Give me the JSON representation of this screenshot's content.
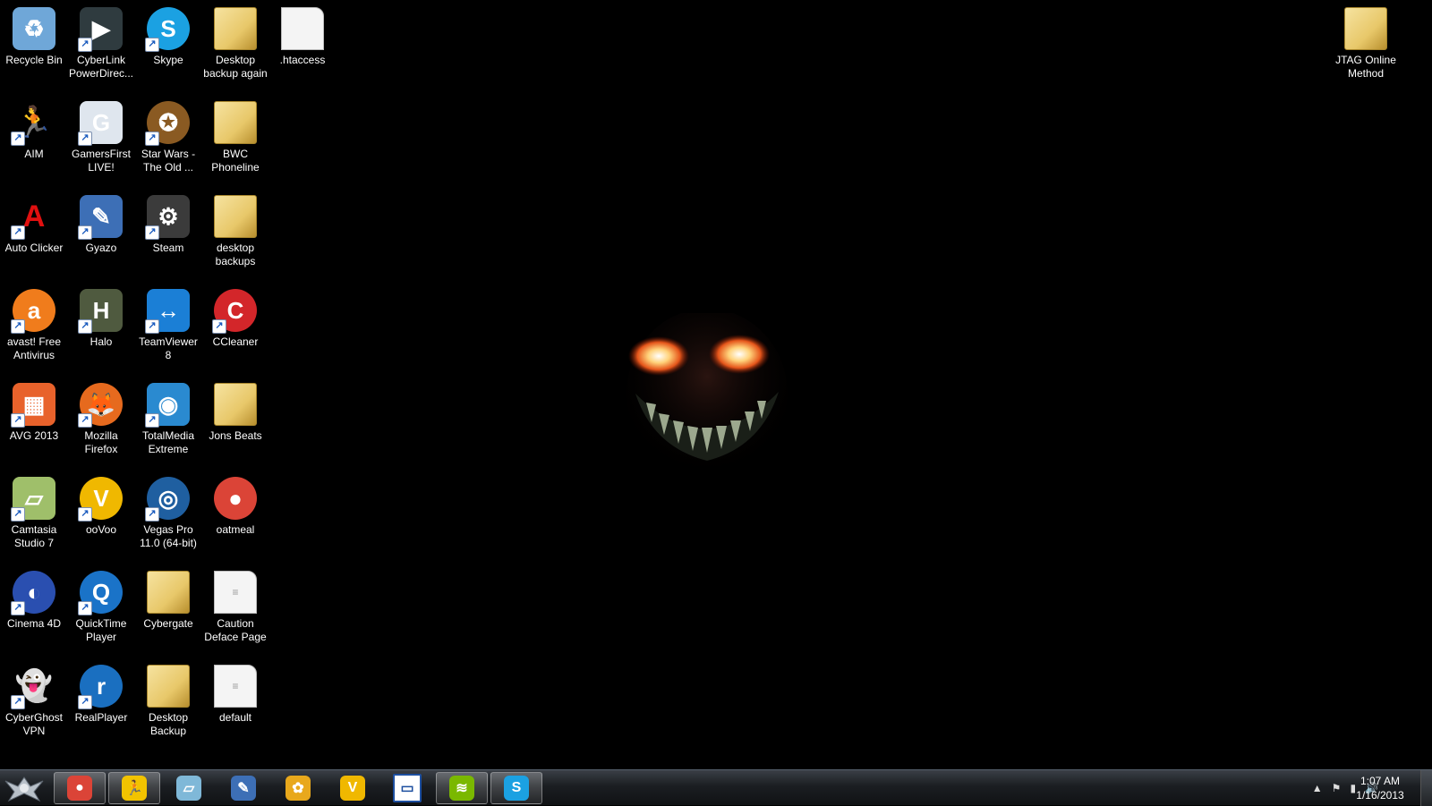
{
  "desktop": {
    "icons": [
      {
        "label": "Recycle Bin",
        "icon": "recycle-bin-icon",
        "color": "#6fa7d8",
        "glyph": "♻",
        "shortcut": false,
        "kind": "app",
        "name": "desktop-icon-recycle-bin"
      },
      {
        "label": "CyberLink PowerDirec...",
        "icon": "cyberlink-powerdirector-icon",
        "color": "#2f3b3f",
        "glyph": "▶",
        "shortcut": true,
        "kind": "app",
        "name": "desktop-icon-cyberlink-powerdirector"
      },
      {
        "label": "Skype",
        "icon": "skype-icon",
        "color": "#1ba1e2",
        "glyph": "S",
        "shortcut": true,
        "kind": "round",
        "name": "desktop-icon-skype"
      },
      {
        "label": "Desktop backup again",
        "icon": "folder-icon",
        "color": "#e8c86a",
        "glyph": "",
        "shortcut": false,
        "kind": "folder",
        "name": "desktop-icon-desktop-backup-again"
      },
      {
        "label": ".htaccess",
        "icon": "file-icon",
        "color": "#f4f4f4",
        "glyph": "",
        "shortcut": false,
        "kind": "file",
        "name": "desktop-icon-htaccess"
      },
      {
        "label": "AIM",
        "icon": "aim-running-man-icon",
        "color": "#000000",
        "glyph": "🏃",
        "shortcut": true,
        "kind": "app",
        "name": "desktop-icon-aim"
      },
      {
        "label": "GamersFirst LIVE!",
        "icon": "gamersfirst-icon",
        "color": "#dfe6ee",
        "glyph": "G",
        "shortcut": true,
        "kind": "app",
        "name": "desktop-icon-gamersfirst"
      },
      {
        "label": "Star Wars - The Old ...",
        "icon": "star-wars-old-republic-icon",
        "color": "#8a5a22",
        "glyph": "✪",
        "shortcut": true,
        "kind": "round",
        "name": "desktop-icon-star-wars"
      },
      {
        "label": "BWC Phoneline",
        "icon": "folder-icon",
        "color": "#e8c86a",
        "glyph": "",
        "shortcut": false,
        "kind": "folder",
        "name": "desktop-icon-bwc-phoneline"
      },
      {
        "label": "Auto Clicker",
        "icon": "auto-clicker-icon",
        "color": "#000000",
        "glyph": "A",
        "shortcut": true,
        "kind": "app",
        "name": "desktop-icon-auto-clicker"
      },
      {
        "label": "Gyazo",
        "icon": "gyazo-icon",
        "color": "#3d6fb6",
        "glyph": "✎",
        "shortcut": true,
        "kind": "app",
        "name": "desktop-icon-gyazo"
      },
      {
        "label": "Steam",
        "icon": "steam-icon",
        "color": "#3b3b3b",
        "glyph": "⚙",
        "shortcut": true,
        "kind": "app",
        "name": "desktop-icon-steam"
      },
      {
        "label": "desktop backups",
        "icon": "folder-icon",
        "color": "#e8c86a",
        "glyph": "",
        "shortcut": false,
        "kind": "folder",
        "name": "desktop-icon-desktop-backups"
      },
      {
        "label": "avast! Free Antivirus",
        "icon": "avast-icon",
        "color": "#f07c1c",
        "glyph": "a",
        "shortcut": true,
        "kind": "round",
        "name": "desktop-icon-avast"
      },
      {
        "label": "Halo",
        "icon": "halo-master-chief-icon",
        "color": "#4f5a3f",
        "glyph": "H",
        "shortcut": true,
        "kind": "app",
        "name": "desktop-icon-halo"
      },
      {
        "label": "TeamViewer 8",
        "icon": "teamviewer-icon",
        "color": "#1b7fd6",
        "glyph": "↔",
        "shortcut": true,
        "kind": "app",
        "name": "desktop-icon-teamviewer"
      },
      {
        "label": "CCleaner",
        "icon": "ccleaner-icon",
        "color": "#d3262a",
        "glyph": "C",
        "shortcut": true,
        "kind": "round",
        "name": "desktop-icon-ccleaner"
      },
      {
        "label": "AVG 2013",
        "icon": "avg-icon",
        "color": "#e8622b",
        "glyph": "▦",
        "shortcut": true,
        "kind": "app",
        "name": "desktop-icon-avg"
      },
      {
        "label": "Mozilla Firefox",
        "icon": "firefox-icon",
        "color": "#e66a1e",
        "glyph": "🦊",
        "shortcut": true,
        "kind": "round",
        "name": "desktop-icon-firefox"
      },
      {
        "label": "TotalMedia Extreme",
        "icon": "totalmedia-icon",
        "color": "#2a8ad0",
        "glyph": "◉",
        "shortcut": true,
        "kind": "app",
        "name": "desktop-icon-totalmedia"
      },
      {
        "label": "Jons Beats",
        "icon": "folder-icon",
        "color": "#e8c86a",
        "glyph": "",
        "shortcut": false,
        "kind": "folder",
        "name": "desktop-icon-jons-beats"
      },
      {
        "label": "Camtasia Studio 7",
        "icon": "camtasia-icon",
        "color": "#9fbf6a",
        "glyph": "▱",
        "shortcut": true,
        "kind": "app",
        "name": "desktop-icon-camtasia"
      },
      {
        "label": "ooVoo",
        "icon": "oovoo-icon",
        "color": "#f0b800",
        "glyph": "V",
        "shortcut": true,
        "kind": "round",
        "name": "desktop-icon-oovoo"
      },
      {
        "label": "Vegas Pro 11.0 (64-bit)",
        "icon": "vegas-pro-icon",
        "color": "#1f5fa0",
        "glyph": "◎",
        "shortcut": true,
        "kind": "round",
        "name": "desktop-icon-vegas-pro"
      },
      {
        "label": "oatmeal",
        "icon": "chrome-icon",
        "color": "#db4437",
        "glyph": "●",
        "shortcut": false,
        "kind": "round",
        "name": "desktop-icon-oatmeal"
      },
      {
        "label": "Cinema 4D",
        "icon": "cinema-4d-icon",
        "color": "#2a4fb0",
        "glyph": "◐",
        "shortcut": true,
        "kind": "round",
        "name": "desktop-icon-cinema-4d"
      },
      {
        "label": "QuickTime Player",
        "icon": "quicktime-icon",
        "color": "#1a73c8",
        "glyph": "Q",
        "shortcut": true,
        "kind": "round",
        "name": "desktop-icon-quicktime"
      },
      {
        "label": "Cybergate",
        "icon": "folder-icon",
        "color": "#e8c86a",
        "glyph": "",
        "shortcut": false,
        "kind": "folder",
        "name": "desktop-icon-cybergate"
      },
      {
        "label": "Caution Deface Page",
        "icon": "text-file-icon",
        "color": "#f4f4f4",
        "glyph": "≡",
        "shortcut": false,
        "kind": "file",
        "name": "desktop-icon-caution-deface-page"
      },
      {
        "label": "CyberGhost VPN",
        "icon": "cyberghost-icon",
        "color": "#000000",
        "glyph": "👻",
        "shortcut": true,
        "kind": "app",
        "name": "desktop-icon-cyberghost"
      },
      {
        "label": "RealPlayer",
        "icon": "realplayer-icon",
        "color": "#1a6fc0",
        "glyph": "r",
        "shortcut": true,
        "kind": "round",
        "name": "desktop-icon-realplayer"
      },
      {
        "label": "Desktop Backup",
        "icon": "folder-icon",
        "color": "#e8c86a",
        "glyph": "",
        "shortcut": false,
        "kind": "folder",
        "name": "desktop-icon-desktop-backup"
      },
      {
        "label": "default",
        "icon": "text-file-icon",
        "color": "#f4f4f4",
        "glyph": "≡",
        "shortcut": false,
        "kind": "file",
        "name": "desktop-icon-default"
      },
      {
        "label": "JTAG Online Method",
        "icon": "folder-icon",
        "color": "#e8c86a",
        "glyph": "",
        "shortcut": false,
        "kind": "folder",
        "name": "desktop-icon-jtag-online-method"
      }
    ]
  },
  "taskbar": {
    "start": {
      "icon": "start-orb-icon",
      "color": "#9aa3ad"
    },
    "buttons": [
      {
        "icon": "chrome-icon",
        "color": "#db4437",
        "glyph": "●",
        "open": true,
        "name": "taskbar-chrome"
      },
      {
        "icon": "aim-running-man-icon",
        "color": "#f2c300",
        "glyph": "🏃",
        "open": true,
        "name": "taskbar-aim"
      },
      {
        "icon": "notepad-icon",
        "color": "#7fb8d8",
        "glyph": "▱",
        "open": false,
        "name": "taskbar-notepad"
      },
      {
        "icon": "gyazo-icon",
        "color": "#3d6fb6",
        "glyph": "✎",
        "open": false,
        "name": "taskbar-gyazo"
      },
      {
        "icon": "fruity-loops-icon",
        "color": "#e8a81c",
        "glyph": "✿",
        "open": false,
        "name": "taskbar-fl-studio"
      },
      {
        "icon": "oovoo-icon",
        "color": "#f0b800",
        "glyph": "V",
        "open": false,
        "name": "taskbar-oovoo"
      },
      {
        "icon": "window-icon",
        "color": "#ffffff",
        "glyph": "▭",
        "open": false,
        "name": "taskbar-window"
      },
      {
        "icon": "spotify-icon",
        "color": "#7ab800",
        "glyph": "≋",
        "open": true,
        "name": "taskbar-spotify"
      },
      {
        "icon": "skype-icon",
        "color": "#1ba1e2",
        "glyph": "S",
        "open": true,
        "name": "taskbar-skype"
      }
    ],
    "tray": [
      {
        "icon": "show-hidden-icons-arrow-icon",
        "glyph": "▲"
      },
      {
        "icon": "action-center-flag-icon",
        "glyph": "⚑"
      },
      {
        "icon": "network-signal-icon",
        "glyph": "▮"
      },
      {
        "icon": "volume-icon",
        "glyph": "🔊"
      }
    ],
    "clock": {
      "time": "1:07 AM",
      "date": "1/16/2013"
    }
  }
}
